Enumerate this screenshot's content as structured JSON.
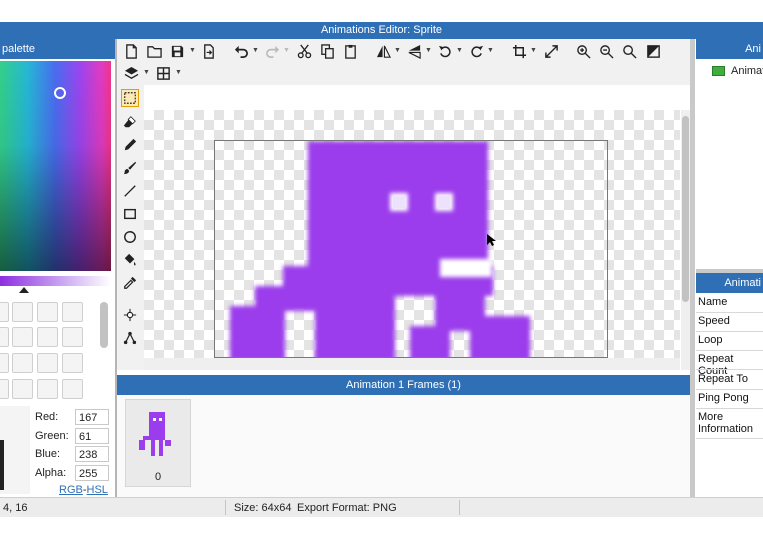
{
  "window": {
    "title": "Animations Editor: Sprite"
  },
  "palette": {
    "header": "palette",
    "red_label": "Red:",
    "red_value": "167",
    "green_label": "Green:",
    "green_value": "61",
    "blue_label": "Blue:",
    "blue_value": "238",
    "alpha_label": "Alpha:",
    "alpha_value": "255",
    "mode_rgb": "RGB",
    "mode_sep": "-",
    "mode_hsl": "HSL"
  },
  "toolbar": {
    "icons": [
      "new-file-icon",
      "open-folder-icon",
      "save-icon",
      "export-icon",
      "undo-icon",
      "redo-icon",
      "cut-icon",
      "copy-icon",
      "paste-icon",
      "flip-horizontal-icon",
      "flip-vertical-icon",
      "rotate-left-icon",
      "rotate-right-icon",
      "crop-icon",
      "resize-icon",
      "zoom-in-icon",
      "zoom-out-icon",
      "zoom-fit-icon",
      "background-toggle-icon",
      "layers-icon",
      "grid-icon"
    ]
  },
  "tools": [
    "selection-tool-icon",
    "eraser-tool-icon",
    "pencil-tool-icon",
    "brush-tool-icon",
    "line-tool-icon",
    "rectangle-tool-icon",
    "ellipse-tool-icon",
    "fill-bucket-tool-icon",
    "eyedropper-tool-icon",
    "point-tool-icon",
    "pivot-tool-icon"
  ],
  "frames": {
    "header": "Animation 1 Frames (1)",
    "items": [
      {
        "label": "0"
      }
    ]
  },
  "animations": {
    "header": "Ani",
    "items": [
      {
        "label": "Animat"
      }
    ]
  },
  "properties": {
    "header": "Animati",
    "rows": [
      "Name",
      "Speed",
      "Loop",
      "Repeat Count",
      "Repeat To",
      "Ping Pong",
      "More Information"
    ]
  },
  "status": {
    "coords": "4, 16",
    "size": "Size: 64x64",
    "export_format": "Export Format: PNG"
  },
  "colors": {
    "accent": "#2f6fb5",
    "sprite": "#9b3dec",
    "current_color": "#a73dee"
  }
}
